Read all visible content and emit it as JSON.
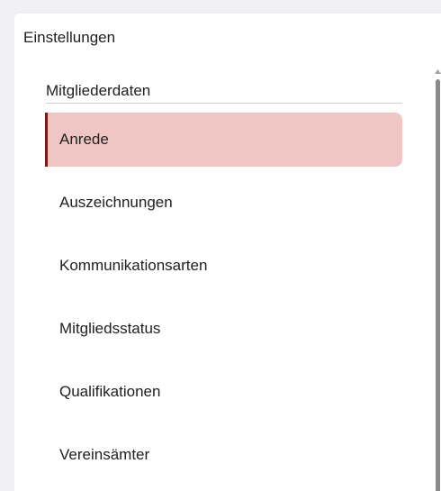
{
  "panel": {
    "title": "Einstellungen"
  },
  "section": {
    "header": "Mitgliederdaten"
  },
  "nav": {
    "active_index": 0,
    "items": [
      {
        "label": "Anrede"
      },
      {
        "label": "Auszeichnungen"
      },
      {
        "label": "Kommunikationsarten"
      },
      {
        "label": "Mitgliedsstatus"
      },
      {
        "label": "Qualifikationen"
      },
      {
        "label": "Vereinsämter"
      }
    ]
  },
  "colors": {
    "active_background": "#f0c6c4",
    "active_indicator": "#7a1c10",
    "scrollbar_thumb": "#8a8a8a"
  },
  "icons": {
    "scroll_up": "triangle-up-icon"
  }
}
